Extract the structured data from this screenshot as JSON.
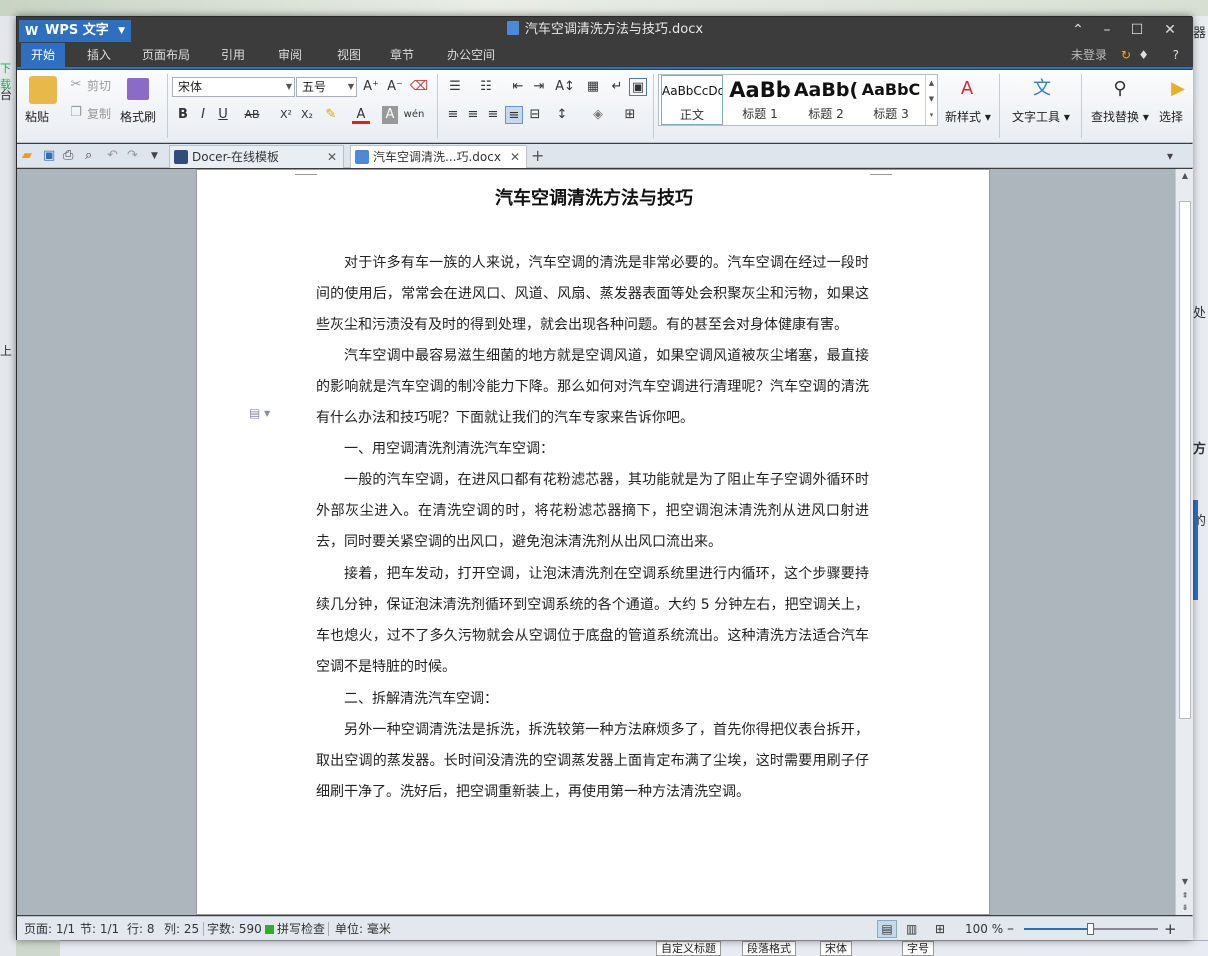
{
  "background": {
    "right_frags": [
      "器",
      "处",
      "方",
      "的",
      "..."
    ],
    "left_frags": [
      "台",
      "下载",
      "上"
    ],
    "bottom_combos": [
      "自定义标题",
      "段落格式",
      "宋体",
      "字号"
    ]
  },
  "window": {
    "app_name": "WPS 文字",
    "doc_title": "汽车空调清洗方法与技巧.docx",
    "minimize_icon": "–",
    "restore_icon": "☐",
    "close_icon": "✕",
    "ribbon_toggle_icon": "⌃"
  },
  "menubar": {
    "items": [
      "开始",
      "插入",
      "页面布局",
      "引用",
      "审阅",
      "视图",
      "章节",
      "办公空间"
    ],
    "login": "未登录",
    "help": "?"
  },
  "ribbon": {
    "paste": "粘贴",
    "cut": "剪切",
    "copy": "复制",
    "format_painter": "格式刷",
    "font_name": "宋体",
    "font_size": "五号",
    "styles": [
      {
        "sample": "AaBbCcDd",
        "name": "正文"
      },
      {
        "sample": "AaBb",
        "name": "标题 1"
      },
      {
        "sample": "AaBb(",
        "name": "标题 2"
      },
      {
        "sample": "AaBbC",
        "name": "标题 3"
      }
    ],
    "new_style": "新样式",
    "text_tools": "文字工具",
    "find_replace": "查找替换",
    "select": "选择"
  },
  "tabs": [
    {
      "label": "Docer-在线模板",
      "active": false
    },
    {
      "label": "汽车空调清洗...巧.docx",
      "active": true
    }
  ],
  "document": {
    "title": "汽车空调清洗方法与技巧",
    "paragraphs": [
      {
        "text": "对于许多有车一族的人来说，汽车空调的清洗是非常必要的。汽车空调在经过一段时间的使用后，常常会在进风口、风道、风扇、蒸发器表面等处会积聚灰尘和污物，如果这些灰尘和污渍没有及时的得到处理，就会出现各种问题。有的甚至会对身体健康有害。",
        "indent": true
      },
      {
        "text": "汽车空调中最容易滋生细菌的地方就是空调风道，如果空调风道被灰尘堵塞，最直接的影响就是汽车空调的制冷能力下降。那么如何对汽车空调进行清理呢？汽车空调的清洗有什么办法和技巧呢？下面就让我们的汽车专家来告诉你吧。",
        "indent": true
      },
      {
        "text": "一、用空调清洗剂清洗汽车空调：",
        "indent": true
      },
      {
        "text": "一般的汽车空调，在进风口都有花粉滤芯器，其功能就是为了阻止车子空调外循环时外部灰尘进入。在清洗空调的时，将花粉滤芯器摘下，把空调泡沫清洗剂从进风口射进去，同时要关紧空调的出风口，避免泡沫清洗剂从出风口流出来。",
        "indent": true
      },
      {
        "text": "接着，把车发动，打开空调，让泡沫清洗剂在空调系统里进行内循环，这个步骤要持续几分钟，保证泡沫清洗剂循环到空调系统的各个通道。大约 5 分钟左右，把空调关上，车也熄火，过不了多久污物就会从空调位于底盘的管道系统流出。这种清洗方法适合汽车空调不是特脏的时候。",
        "indent": true
      },
      {
        "text": "二、拆解清洗汽车空调：",
        "indent": true
      },
      {
        "text": "另外一种空调清洗法是拆洗，拆洗较第一种方法麻烦多了，首先你得把仪表台拆开，取出空调的蒸发器。长时间没清洗的空调蒸发器上面肯定布满了尘埃，这时需要用刷子仔细刷干净了。洗好后，把空调重新装上，再使用第一种方法清洗空调。",
        "indent": true
      }
    ]
  },
  "status": {
    "page": "页面: 1/1",
    "section": "节: 1/1",
    "row": "行: 8",
    "col": "列: 25",
    "words": "字数: 590",
    "spell": "拼写检查",
    "unit": "单位: 毫米",
    "zoom": "100 %",
    "zoom_fraction": 0.5
  },
  "colors": {
    "accent": "#2f6fc0",
    "titlebar": "#3c3c3c"
  }
}
